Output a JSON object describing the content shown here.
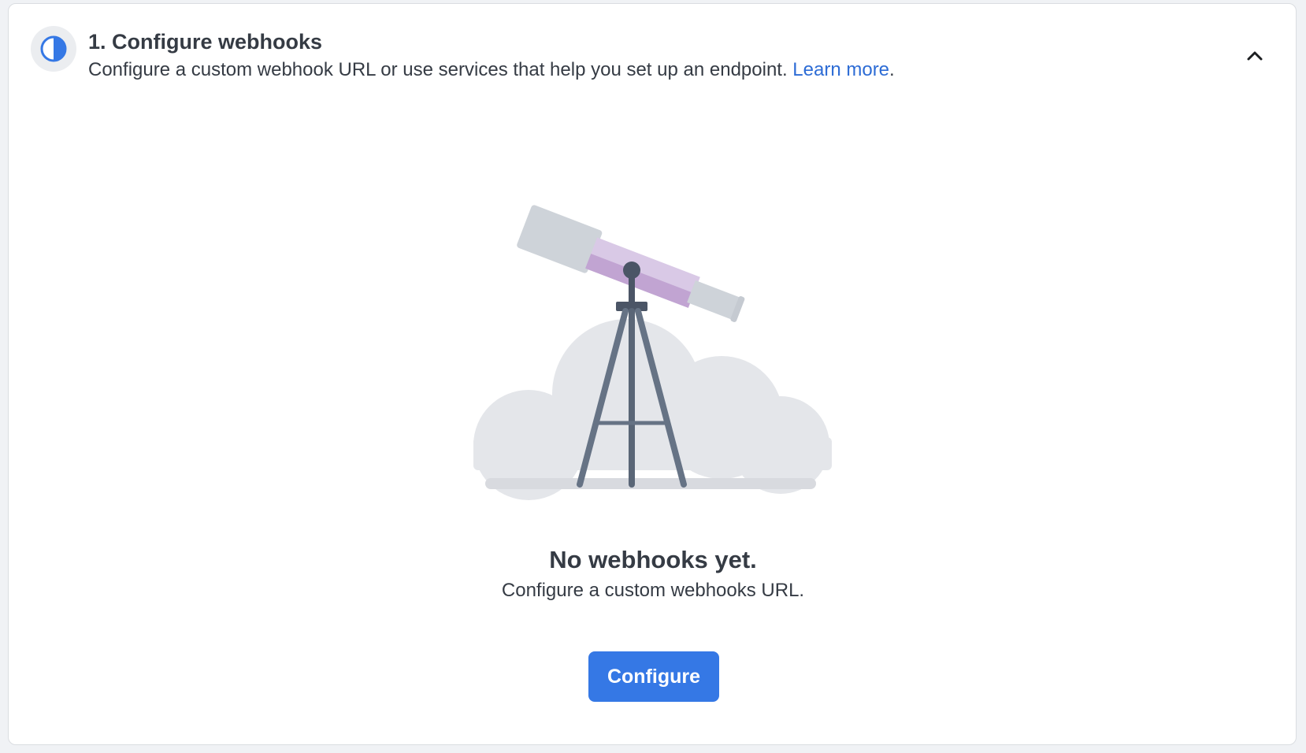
{
  "step": {
    "icon": "half-circle-progress-icon",
    "title": "1. Configure webhooks",
    "description": "Configure a custom webhook URL or use services that help you set up an endpoint.",
    "learn_more_label": "Learn more",
    "description_suffix": ".",
    "collapse_icon": "chevron-up-icon"
  },
  "empty_state": {
    "illustration": "telescope-illustration",
    "title": "No webhooks yet.",
    "subtitle": "Configure a custom webhooks URL.",
    "button_label": "Configure"
  },
  "colors": {
    "accent": "#3578e5",
    "link": "#2d6cd5",
    "text": "#353b44",
    "telescope_purple": "#c9b3d9"
  }
}
